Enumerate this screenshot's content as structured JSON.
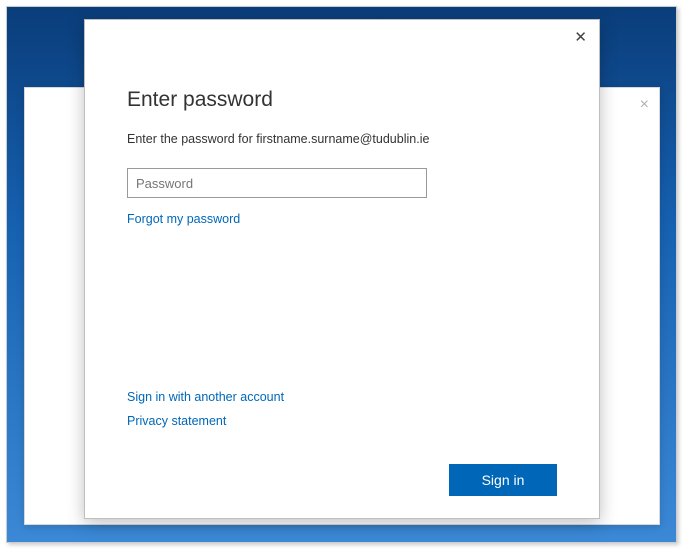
{
  "modal": {
    "title": "Enter password",
    "subtitle": "Enter the password for firstname.surname@tudublin.ie",
    "password_placeholder": "Password",
    "password_value": "",
    "forgot_link": "Forgot my password",
    "another_account_link": "Sign in with another account",
    "privacy_link": "Privacy statement",
    "signin_button": "Sign in"
  }
}
